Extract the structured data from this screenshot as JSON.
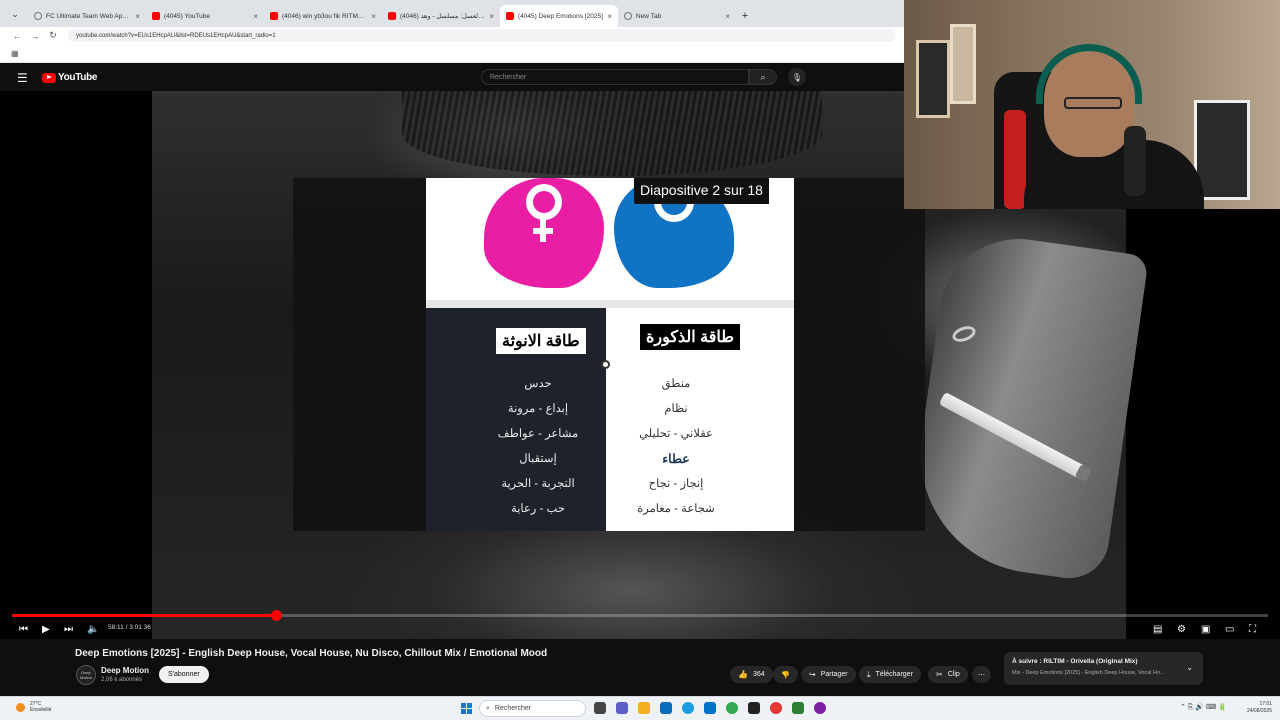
{
  "browser": {
    "tabs": [
      {
        "label": "FC Ultimate Team Web App - E",
        "icon": "globe-icon",
        "active": false
      },
      {
        "label": "(4045) YouTube",
        "icon": "youtube-icon",
        "active": false
      },
      {
        "label": "(4046) win yb3ou fik RITMA B",
        "icon": "youtube-icon",
        "active": false
      },
      {
        "label": "(4046) شهر العسل: مسلسل - وهد",
        "icon": "youtube-icon",
        "active": false
      },
      {
        "label": "(4045) Deep Emotions [2025]",
        "icon": "youtube-icon",
        "active": true
      },
      {
        "label": "New Tab",
        "icon": "globe-icon",
        "active": false
      }
    ],
    "url": "youtube.com/watch?v=EUs1EHcpAU&list=RDEUs1EHcpAU&start_radio=1"
  },
  "youtube": {
    "logo_text": "YouTube",
    "search_placeholder": "Rechercher"
  },
  "slide": {
    "counter": "Diapositive 2 sur 18",
    "left_title": "طاقة الانوثة",
    "right_title": "طاقة الذكورة",
    "left_items": [
      "حدس",
      "إبداع - مرونة",
      "مشاعر - عواطف",
      "إستقبال",
      "التجربة - الحرية",
      "حب - رعاية",
      "..."
    ],
    "right_items": [
      "منطق",
      "نظام",
      "عقلاني - تحليلي",
      "عطاء",
      "إنجاز - نجاح",
      "شجاعة - مغامرة"
    ],
    "right_bold_index": 3
  },
  "player": {
    "time": "58:11 / 3:01:36",
    "progress_fraction": 0.21
  },
  "video": {
    "title": "Deep Emotions [2025] - English Deep House, Vocal House, Nu Disco, Chillout Mix / Emotional Mood",
    "channel": "Deep Motion",
    "channel_avatar_text": "Deep Motion",
    "subscribers": "2,06 k abonnés",
    "subscribe_label": "S'abonner",
    "likes": "364",
    "share_label": "Partager",
    "download_label": "Télécharger",
    "clip_label": "Clip",
    "up_next_title": "À suivre : RILTIM - Orivella (Original Mix)",
    "up_next_sub": "Mix - Deep Emotions [2025] - English Deep House, Vocal Ho..."
  },
  "taskbar": {
    "temperature": "27°C",
    "weather_desc": "Ensoleillé",
    "search_placeholder": "Rechercher",
    "time": "17:01",
    "date": "24/08/2025"
  }
}
